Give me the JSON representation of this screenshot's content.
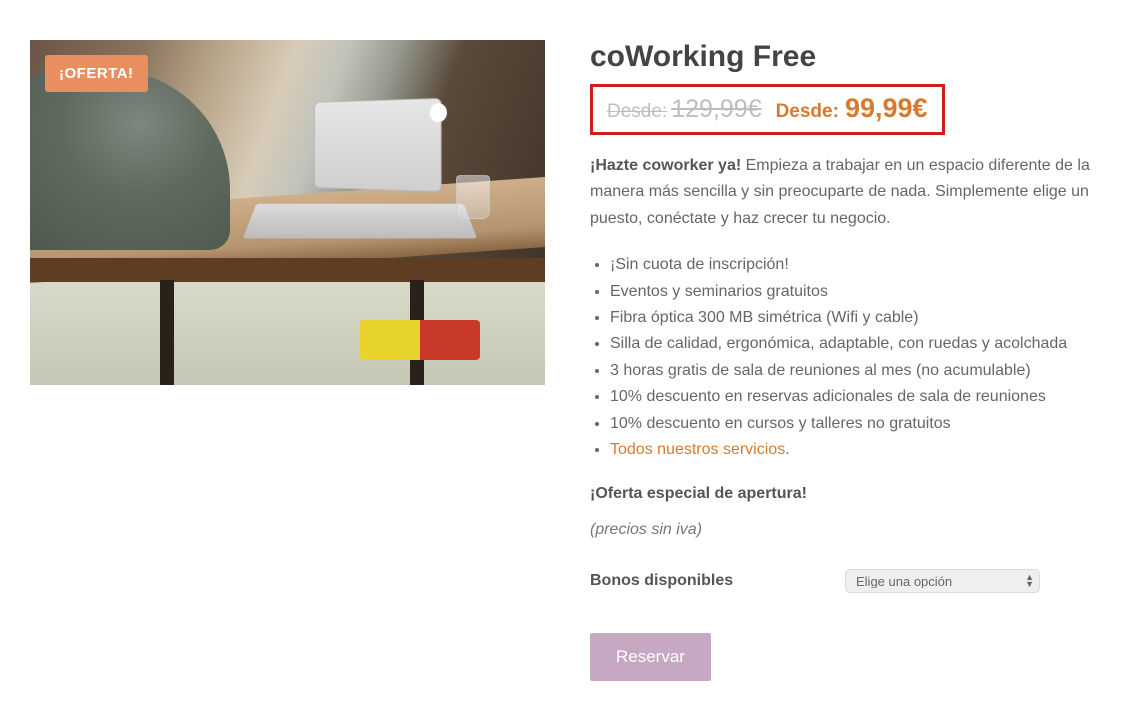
{
  "badge": "¡OFERTA!",
  "title": "coWorking Free",
  "price": {
    "old_label": "Desde:",
    "old_amount": "129,99€",
    "new_label": "Desde:",
    "new_amount": "99,99€"
  },
  "description": {
    "lead": "¡Hazte coworker ya!",
    "rest": " Empieza a trabajar en un espacio diferente de la manera más sencilla y sin preocuparte de nada. Simplemente elige un puesto, conéctate y haz crecer tu negocio."
  },
  "features": [
    "¡Sin cuota de inscripción!",
    "Eventos y seminarios gratuitos",
    "Fibra óptica 300 MB simétrica (Wifi y cable)",
    "Silla de calidad, ergonómica, adaptable, con ruedas y acolchada",
    "3 horas gratis de sala de reuniones al mes (no acumulable)",
    "10% descuento en reservas adicionales de sala de reuniones",
    "10% descuento en cursos y talleres no gratuitos"
  ],
  "features_link": {
    "text": "Todos nuestros servicios",
    "suffix": "."
  },
  "offer_note": "¡Oferta especial de apertura!",
  "tax_note": "(precios sin iva)",
  "variation": {
    "label": "Bonos disponibles",
    "placeholder": "Elige una opción"
  },
  "cta": "Reservar"
}
